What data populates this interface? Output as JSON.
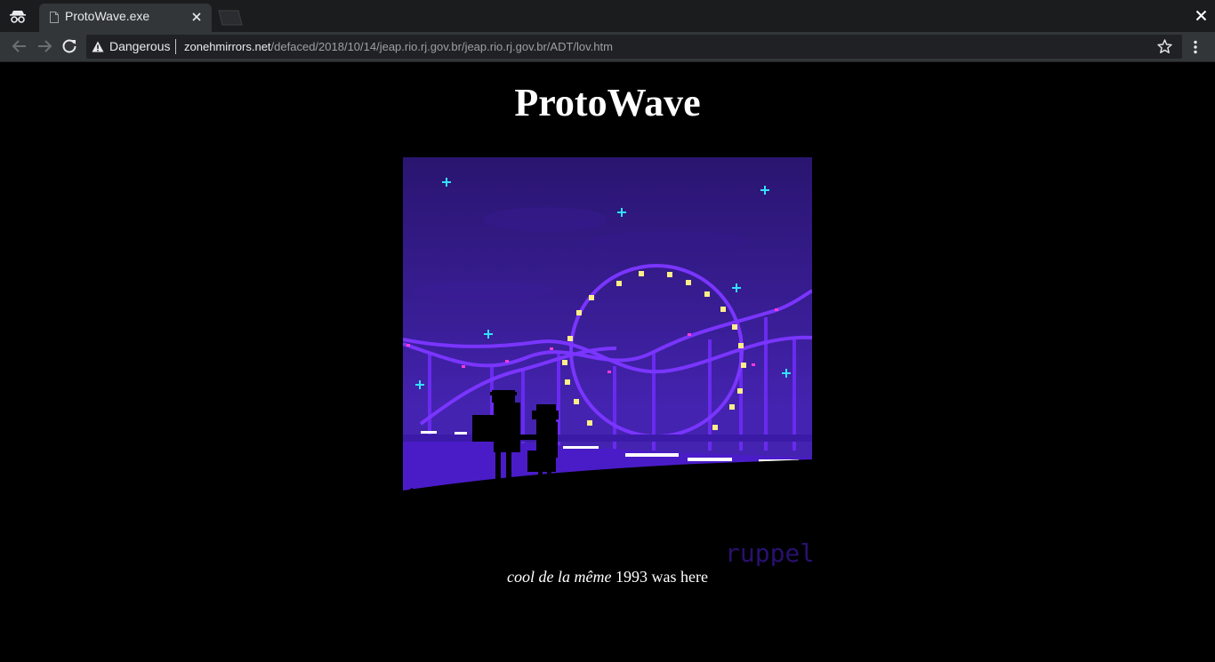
{
  "browser": {
    "tab_title": "ProtoWave.exe",
    "security_label": "Dangerous",
    "url_host": "zonehmirrors.net",
    "url_path": "/defaced/2018/10/14/jeap.rio.rj.gov.br/jeap.rio.rj.gov.br/ADT/lov.htm",
    "icons": {
      "incognito": "incognito-icon",
      "tab": "document-icon",
      "close": "close-icon",
      "back": "back-arrow-icon",
      "forward": "forward-arrow-icon",
      "reload": "reload-icon",
      "warning": "warning-triangle-icon",
      "bookmark": "star-icon",
      "menu": "kebab-menu-icon"
    }
  },
  "page": {
    "heading": "ProtoWave",
    "artwork": {
      "signature": "ruppel"
    },
    "caption_italic": "cool de la même",
    "caption_rest": " 1993 was here"
  },
  "colors": {
    "page_bg": "#000000",
    "chrome_bg": "#1b1c1e",
    "toolbar_bg": "#323639",
    "sky_top": "#2a1570",
    "sky_bottom": "#3b1f9e",
    "coaster": "#6f2bff",
    "light_yellow": "#ffee88",
    "star_cyan": "#33e0ff"
  }
}
